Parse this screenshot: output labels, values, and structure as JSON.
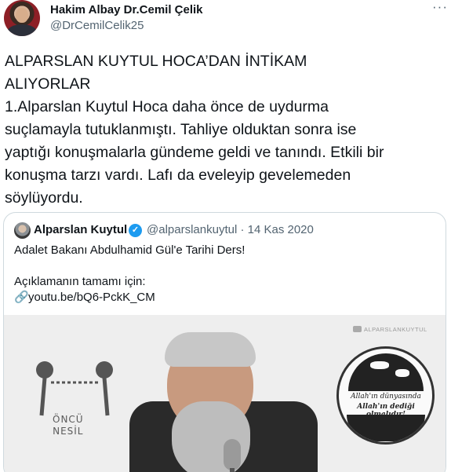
{
  "author": {
    "name": "Hakim Albay Dr.Cemil Çelik",
    "handle": "@DrCemilCelik25"
  },
  "more_icon": "more-dots-icon",
  "tweet": {
    "lines": [
      "ALPARSLAN KUYTUL HOCA’DAN İNTİKAM",
      "ALIYORLAR",
      "1.Alparslan Kuytul Hoca daha önce de uydurma",
      "suçlamayla tutuklanmıştı. Tahliye olduktan sonra ise",
      "yaptığı konuşmalarla gündeme geldi ve tanındı. Etkili bir",
      "konuşma tarzı vardı. Lafı da eveleyip gevelemeden",
      "söylüyordu."
    ]
  },
  "quoted": {
    "name": "Alparslan Kuytul",
    "verified_icon": "verified-badge-icon",
    "handle_date": "@alparslankuytul · 14 Kas 2020",
    "text_line1": "Adalet Bakanı Abdulhamid Gül'e Tarihi Ders!",
    "text_line3": "Açıklamanın tamamı için:",
    "link_icon": "link-icon",
    "link": "youtu.be/bQ6-PckK_CM"
  },
  "media": {
    "watermark": "ALPARSLANKUYTUL",
    "wall_logo_text": [
      "ÖNCÜ",
      "NESİL"
    ],
    "badge_line1": "Allah'ın dünyasında",
    "badge_line2": "Allah'ın dediği olmalıdır!"
  },
  "colors": {
    "text": "#0f1419",
    "secondary": "#536471",
    "border": "#cfd9de",
    "verified": "#1d9bf0"
  }
}
